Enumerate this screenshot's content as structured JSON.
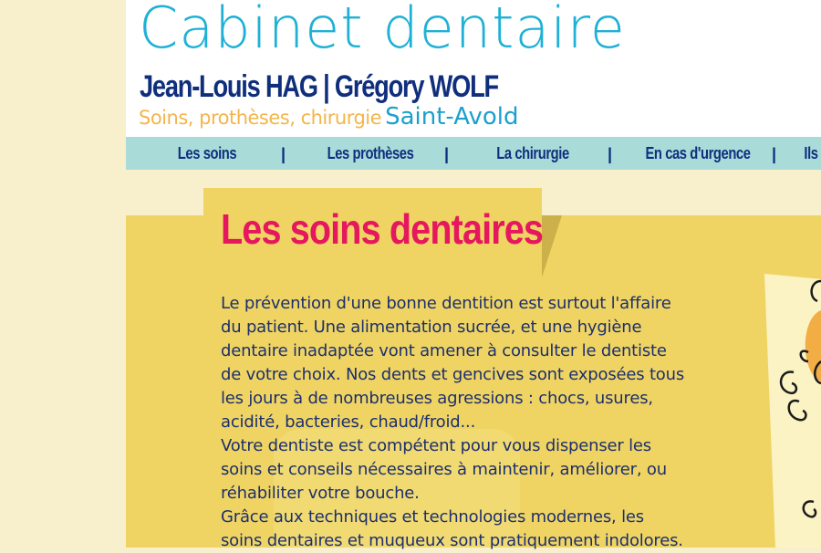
{
  "header": {
    "title": "Cabinet dentaire",
    "doctors": "Jean-Louis HAG | Grégory WOLF",
    "services": "Soins, prothèses, chirurgie",
    "city": "Saint-Avold"
  },
  "nav": {
    "items": [
      {
        "label": "Les soins"
      },
      {
        "label": "Les prothèses"
      },
      {
        "label": "La chirurgie"
      },
      {
        "label": "En cas d'urgence"
      },
      {
        "label": "Ils"
      }
    ],
    "separator": "|"
  },
  "main": {
    "heading": "Les soins dentaires",
    "paragraphs": [
      "Le prévention d'une bonne dentition est surtout l'affaire du patient. Une alimentation sucrée, et une hygiène dentaire inadaptée vont amener à consulter le dentiste de votre choix. Nos dents et gencives sont exposées tous les jours à de nombreuses agressions : chocs, usures, acidité, bacteries, chaud/froid...",
      "Votre dentiste est compétent pour vous dispenser les soins et conseils nécessaires à maintenir, améliorer, ou réhabiliter votre bouche.",
      "Grâce aux techniques et technologies modernes, les soins dentaires et muqueux sont pratiquement indolores."
    ]
  },
  "colors": {
    "background": "#f8f0cc",
    "title": "#1fb0d6",
    "doctors": "#0f2f7d",
    "services": "#f4b54a",
    "nav_bg": "#a9dbd9",
    "panel": "#efd463",
    "heading": "#e5175e",
    "body_text": "#1c2f6e"
  },
  "icons": [
    "decorative-swirl-icon"
  ]
}
